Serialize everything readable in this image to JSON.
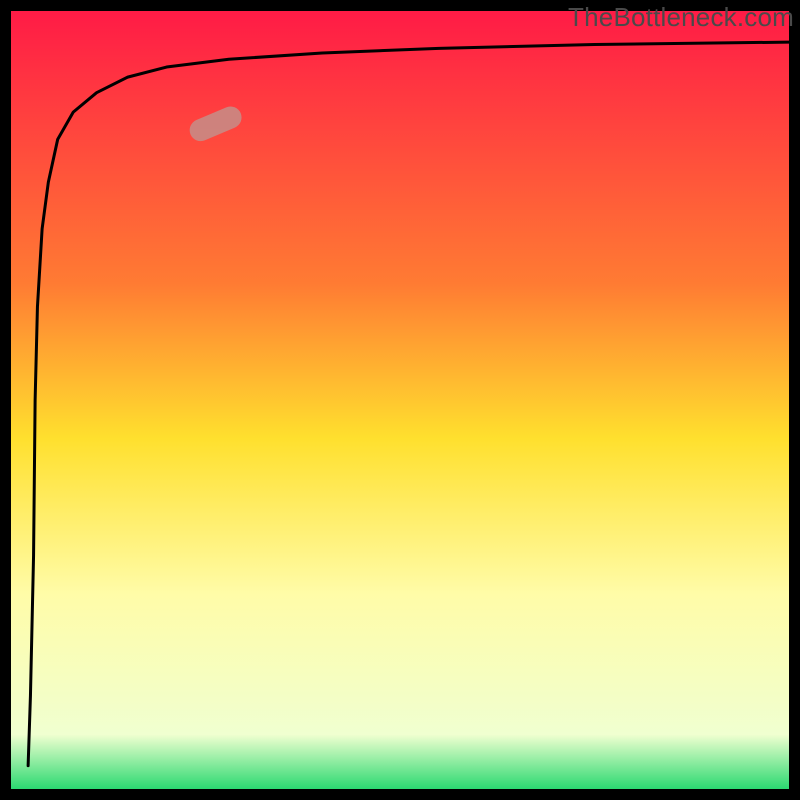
{
  "watermark": "TheBottleneck.com",
  "chart_data": {
    "type": "line",
    "title": "",
    "xlabel": "",
    "ylabel": "",
    "xlim": [
      0,
      100
    ],
    "ylim": [
      0,
      100
    ],
    "axes_visible": false,
    "grid": false,
    "background_gradient": {
      "stops": [
        {
          "offset": 0.0,
          "color": "#ff1b46"
        },
        {
          "offset": 0.35,
          "color": "#ff7b33"
        },
        {
          "offset": 0.55,
          "color": "#ffe02e"
        },
        {
          "offset": 0.75,
          "color": "#fffca8"
        },
        {
          "offset": 0.93,
          "color": "#f0ffd0"
        },
        {
          "offset": 1.0,
          "color": "#2bd971"
        }
      ]
    },
    "frame_color": "#000000",
    "frame_thickness_px": 11,
    "series": [
      {
        "name": "bottleneck-curve",
        "color": "#000000",
        "stroke_px": 3,
        "x": [
          2.2,
          2.5,
          2.9,
          3.1,
          3.4,
          4.0,
          4.8,
          6.0,
          8.0,
          11.0,
          15.0,
          20.0,
          28.0,
          40.0,
          55.0,
          75.0,
          100.0
        ],
        "y": [
          3.0,
          12.0,
          30.0,
          50.0,
          62.0,
          72.0,
          78.0,
          83.5,
          87.0,
          89.5,
          91.5,
          92.8,
          93.8,
          94.6,
          95.2,
          95.7,
          96.0
        ]
      }
    ],
    "marker": {
      "name": "highlight-segment",
      "color": "#c98a84",
      "opacity": 0.9,
      "shape": "capsule",
      "center": {
        "x": 26.3,
        "y": 85.5
      },
      "length": 7.0,
      "thickness_px": 22,
      "angle_deg": 23
    }
  }
}
